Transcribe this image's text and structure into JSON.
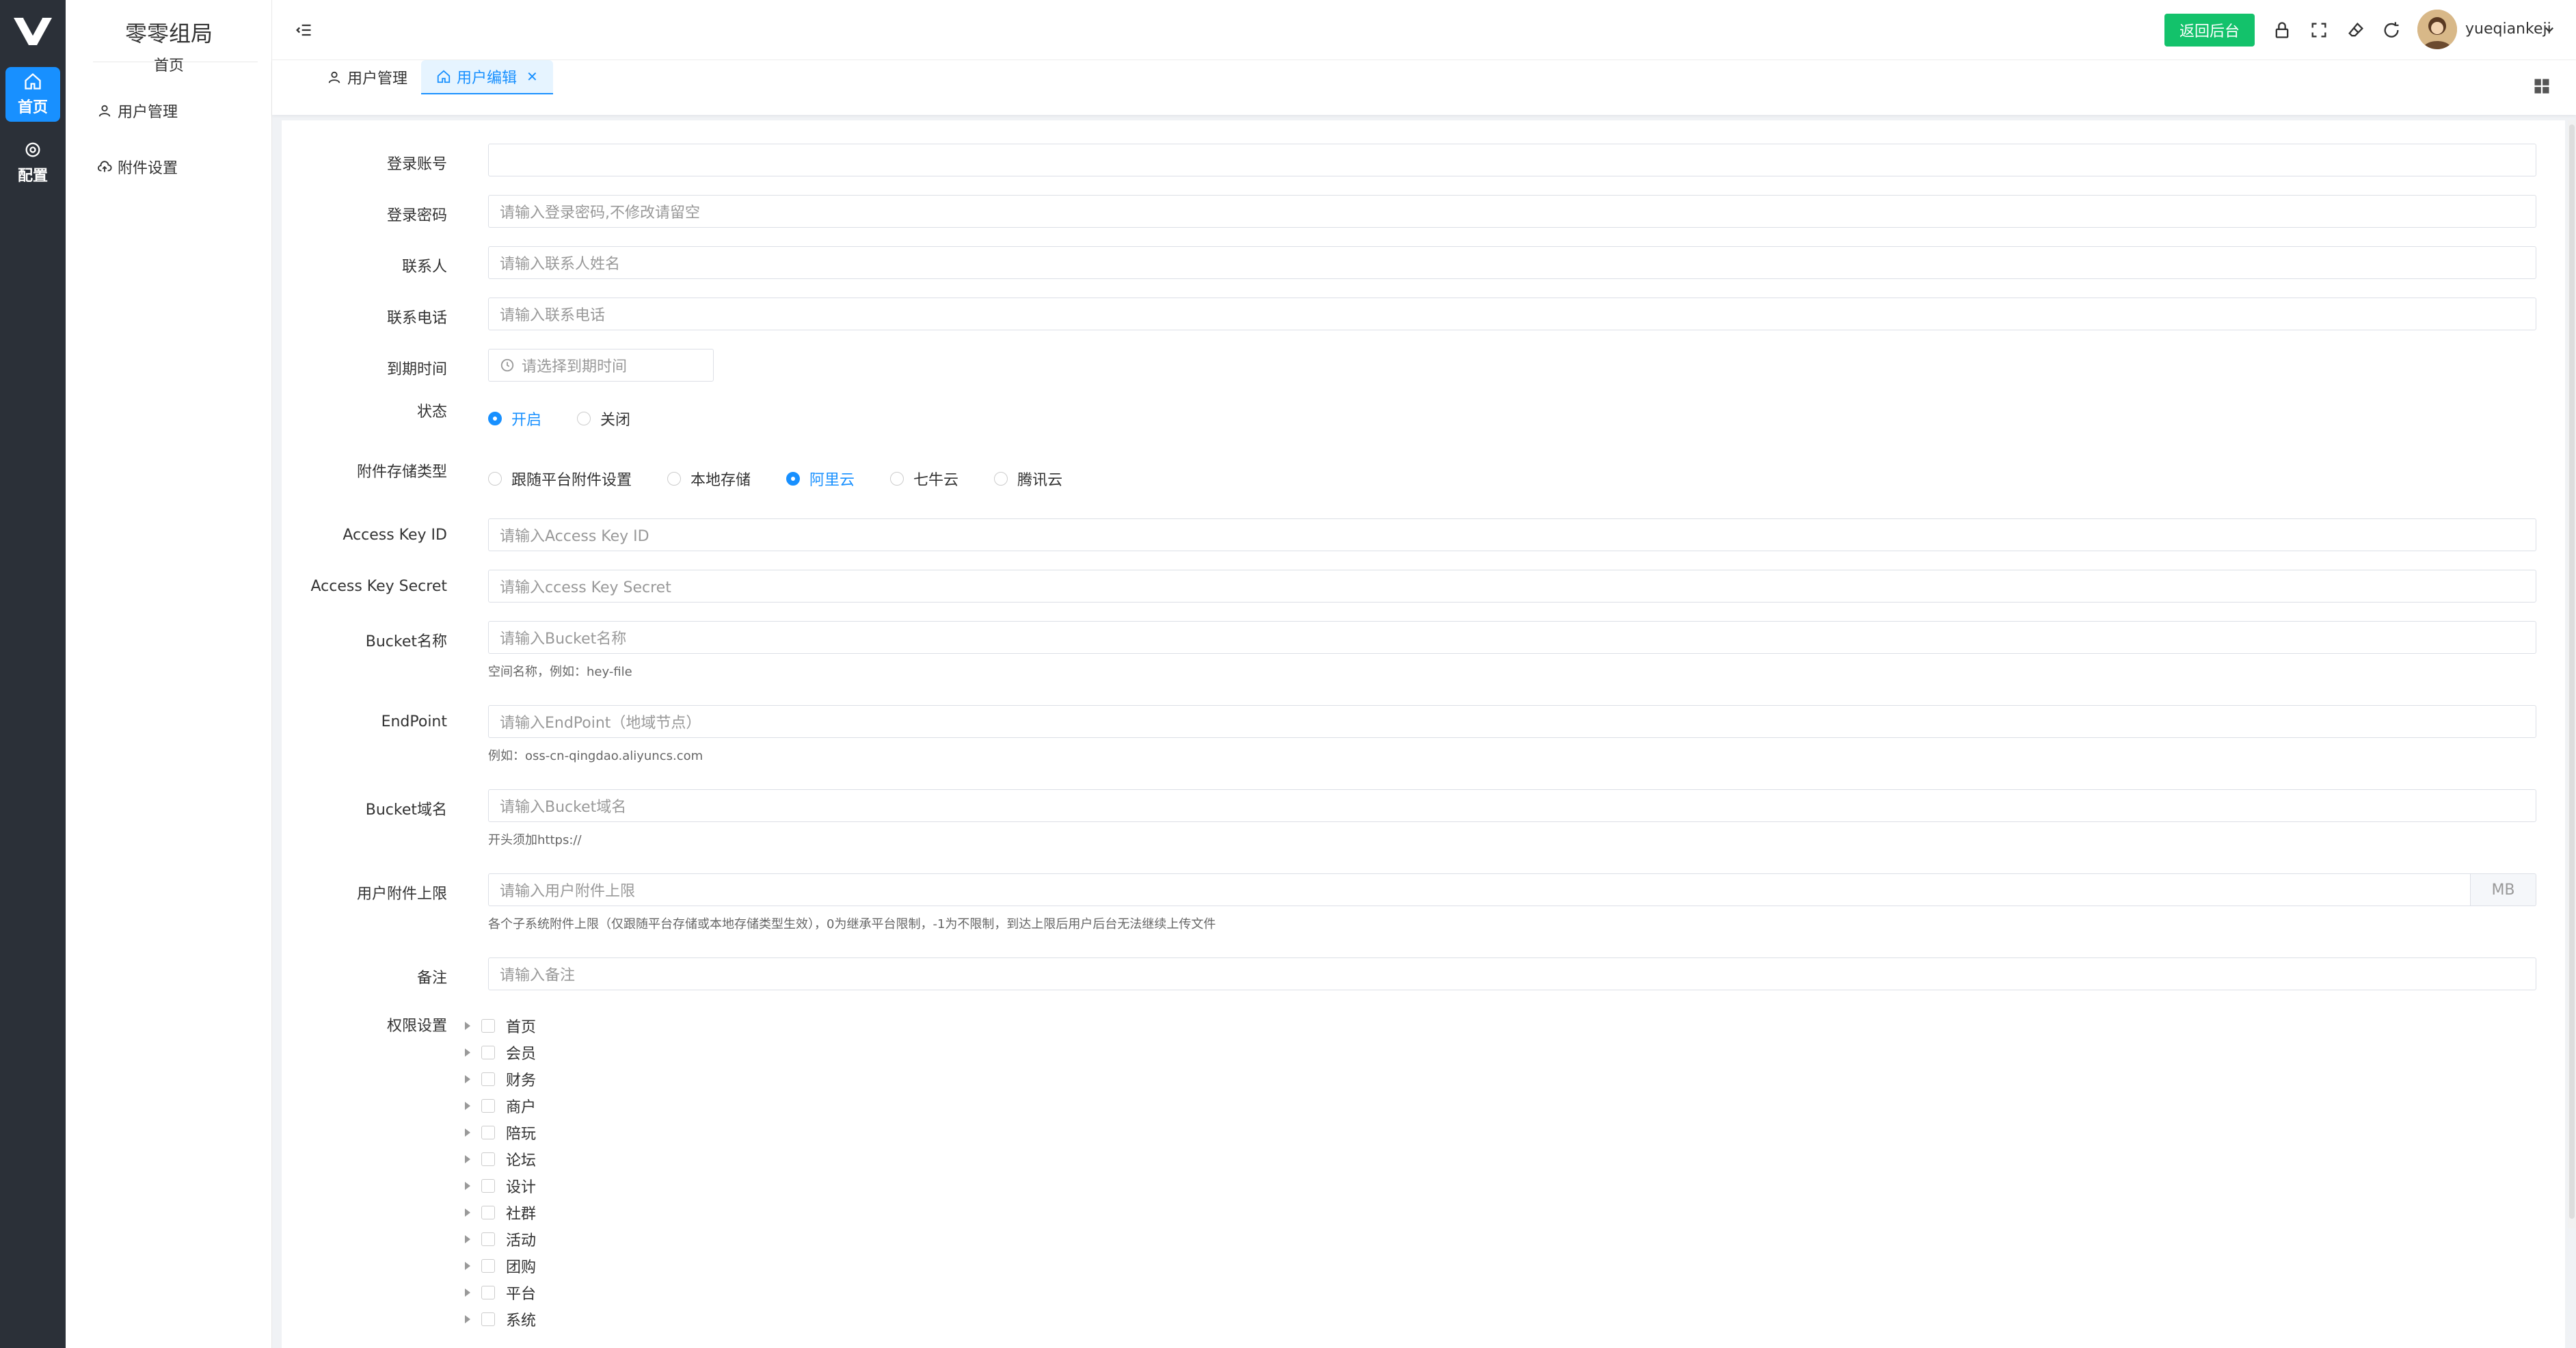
{
  "rail": {
    "items": [
      {
        "label": "首页",
        "icon": "home-icon",
        "active": true
      },
      {
        "label": "配置",
        "icon": "settings-icon",
        "active": false
      }
    ]
  },
  "submenu": {
    "title": "零零组局",
    "subtitle": "首页",
    "items": [
      {
        "label": "用户管理",
        "icon": "user-icon"
      },
      {
        "label": "附件设置",
        "icon": "cloud-upload-icon"
      }
    ]
  },
  "header": {
    "back_button": "返回后台",
    "username": "yueqiankeji"
  },
  "tabs": [
    {
      "label": "用户管理",
      "icon": "user-icon",
      "active": false
    },
    {
      "label": "用户编辑",
      "icon": "home-icon",
      "active": true
    }
  ],
  "form": {
    "login_account": {
      "label": "登录账号",
      "placeholder": ""
    },
    "login_password": {
      "label": "登录密码",
      "placeholder": "请输入登录密码,不修改请留空"
    },
    "contact_person": {
      "label": "联系人",
      "placeholder": "请输入联系人姓名"
    },
    "contact_phone": {
      "label": "联系电话",
      "placeholder": "请输入联系电话"
    },
    "expire_time": {
      "label": "到期时间",
      "placeholder": "请选择到期时间"
    },
    "status": {
      "label": "状态",
      "options": [
        {
          "label": "开启",
          "checked": true
        },
        {
          "label": "关闭",
          "checked": false
        }
      ]
    },
    "storage_type": {
      "label": "附件存储类型",
      "options": [
        {
          "label": "跟随平台附件设置",
          "checked": false
        },
        {
          "label": "本地存储",
          "checked": false
        },
        {
          "label": "阿里云",
          "checked": true
        },
        {
          "label": "七牛云",
          "checked": false
        },
        {
          "label": "腾讯云",
          "checked": false
        }
      ]
    },
    "access_key_id": {
      "label": "Access Key ID",
      "placeholder": "请输入Access Key ID"
    },
    "access_key_secret": {
      "label": "Access Key Secret",
      "placeholder": "请输入ccess Key Secret"
    },
    "bucket_name": {
      "label": "Bucket名称",
      "placeholder": "请输入Bucket名称",
      "hint": "空间名称，例如：hey-file"
    },
    "endpoint": {
      "label": "EndPoint",
      "placeholder": "请输入EndPoint（地域节点）",
      "hint": "例如：oss-cn-qingdao.aliyuncs.com"
    },
    "bucket_domain": {
      "label": "Bucket域名",
      "placeholder": "请输入Bucket域名",
      "hint": "开头须加https://"
    },
    "attachment_limit": {
      "label": "用户附件上限",
      "placeholder": "请输入用户附件上限",
      "suffix": "MB",
      "hint": "各个子系统附件上限（仅跟随平台存储或本地存储类型生效），0为继承平台限制，-1为不限制，到达上限后用户后台无法继续上传文件"
    },
    "remark": {
      "label": "备注",
      "placeholder": "请输入备注"
    },
    "permissions": {
      "label": "权限设置",
      "items": [
        "首页",
        "会员",
        "财务",
        "商户",
        "陪玩",
        "论坛",
        "设计",
        "社群",
        "活动",
        "团购",
        "平台",
        "系统"
      ]
    }
  },
  "colors": {
    "primary": "#1890ff",
    "success": "#13c26b",
    "rail": "#2b3038"
  }
}
